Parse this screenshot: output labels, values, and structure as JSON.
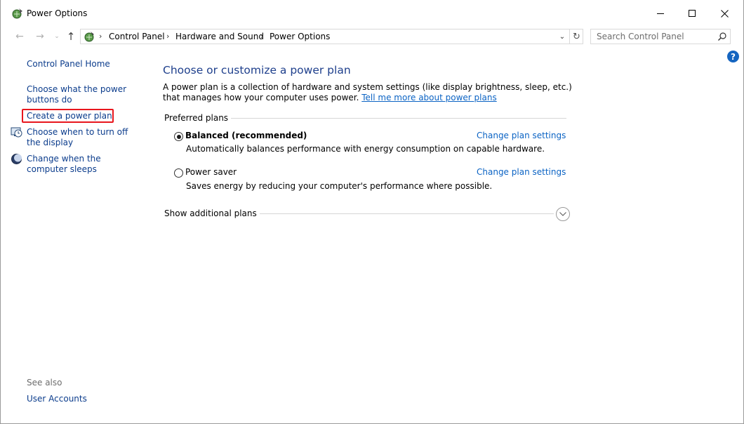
{
  "window": {
    "title": "Power Options"
  },
  "address": {
    "crumbs": [
      "Control Panel",
      "Hardware and Sound",
      "Power Options"
    ]
  },
  "search": {
    "placeholder": "Search Control Panel"
  },
  "help": {
    "glyph": "?"
  },
  "sidebar": {
    "home": "Control Panel Home",
    "items": [
      "Choose what the power buttons do",
      "Create a power plan",
      "Choose when to turn off the display",
      "Change when the computer sleeps"
    ],
    "see_also": "See also",
    "user_accounts": "User Accounts"
  },
  "main": {
    "title": "Choose or customize a power plan",
    "description": "A power plan is a collection of hardware and system settings (like display brightness, sleep, etc.) that manages how your computer uses power.",
    "learn_more": "Tell me more about power plans",
    "preferred_label": "Preferred plans",
    "plans": [
      {
        "name": "Balanced (recommended)",
        "description": "Automatically balances performance with energy consumption on capable hardware.",
        "link": "Change plan settings",
        "selected": true
      },
      {
        "name": "Power saver",
        "description": "Saves energy by reducing your computer's performance where possible.",
        "link": "Change plan settings",
        "selected": false
      }
    ],
    "additional_label": "Show additional plans"
  },
  "colors": {
    "link": "#0b3c8c",
    "title": "#1e3f8c",
    "highlight": "#e8161d",
    "help": "#1565c0"
  }
}
